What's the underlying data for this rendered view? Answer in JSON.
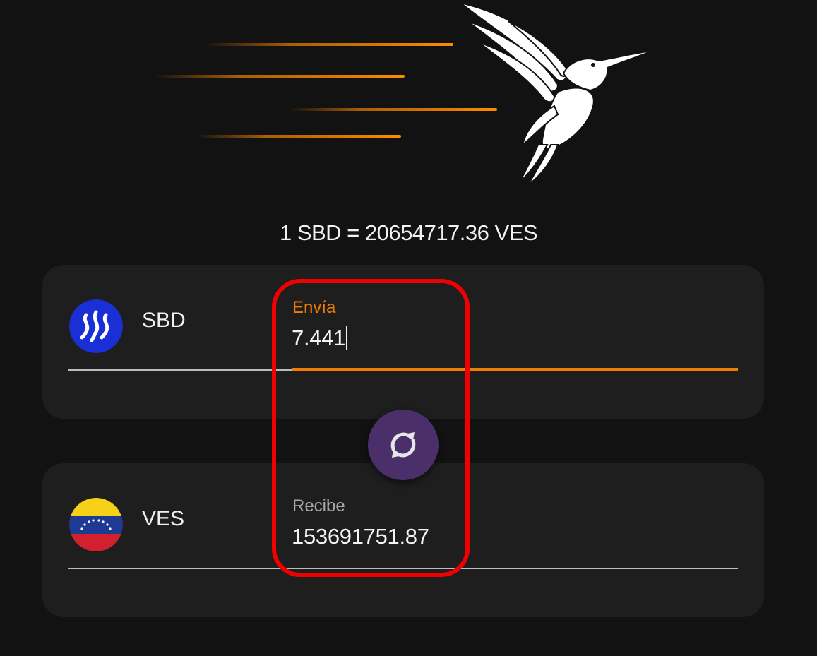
{
  "rate_text": "1 SBD = 20654717.36 VES",
  "send": {
    "coin_name": "SBD",
    "coin_icon": "steem-dollars-icon",
    "label": "Envía",
    "value": "7.441"
  },
  "receive": {
    "coin_name": "VES",
    "coin_icon": "venezuela-flag-icon",
    "label": "Recibe",
    "value": "153691751.87"
  },
  "swap_icon": "swap-arrows-icon",
  "colors": {
    "accent": "#f07c00",
    "swap_button": "#4a2f6b",
    "highlight": "#f00000",
    "card": "#1e1e1e",
    "background": "#121212"
  }
}
